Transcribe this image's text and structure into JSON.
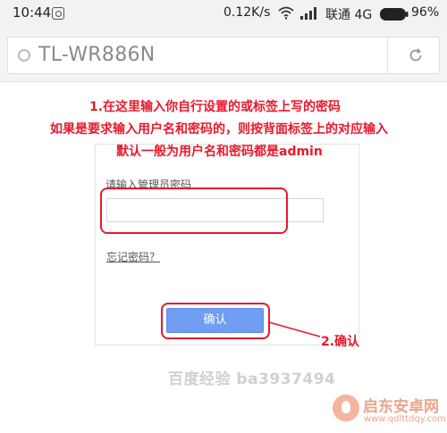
{
  "status_bar": {
    "time": "10:44",
    "app_icon": "gallery-icon",
    "net_speed": "0.12K/s",
    "wifi_icon": "wifi-icon",
    "signal_icon": "signal-icon",
    "carrier": "联通 4G",
    "battery_icon": "battery-icon",
    "battery_pct": "96%"
  },
  "browser": {
    "url_text": "TL-WR886N",
    "site_icon": "circle-icon",
    "reload_icon": "reload-icon"
  },
  "annotations": {
    "line1": "1.在这里输入你自行设置的或标签上写的密码",
    "line2": "如果是要求输入用户名和密码的，则按背面标签上的对应输入",
    "line3": "默认一般为用户名和密码都是admin",
    "step2": "2.确认"
  },
  "login": {
    "password_label": "请输入管理员密码",
    "password_value": "",
    "forgot_link": "忘记密码？",
    "confirm_label": "确认"
  },
  "watermarks": {
    "baidu": "百度经验 ba3937494",
    "site_name": "启东安卓网",
    "site_url": "www.qdlttdqy.com"
  },
  "colors": {
    "annotation_red": "#e8192c",
    "button_blue": "#6f9ef2"
  }
}
